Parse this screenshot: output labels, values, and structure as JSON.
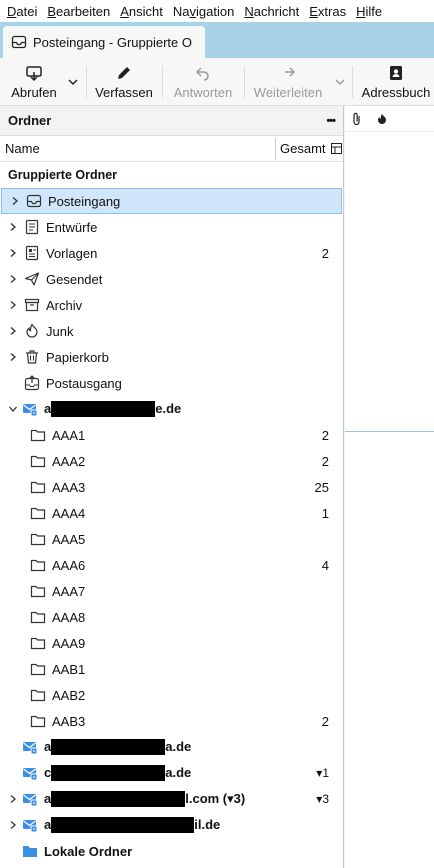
{
  "menubar": {
    "items": [
      {
        "u": "D",
        "rest": "atei"
      },
      {
        "u": "B",
        "rest": "earbeiten"
      },
      {
        "u": "A",
        "rest": "nsicht"
      },
      {
        "u": "",
        "pre": "Na",
        "mid": "v",
        "post": "igation"
      },
      {
        "u": "N",
        "rest": "achricht"
      },
      {
        "u": "E",
        "rest": "xtras"
      },
      {
        "u": "H",
        "rest": "ilfe"
      }
    ]
  },
  "tab": {
    "title": "Posteingang - Gruppierte O"
  },
  "toolbar": {
    "get_messages": "Abrufen",
    "compose": "Verfassen",
    "reply": "Antworten",
    "forward": "Weiterleiten",
    "address_book": "Adressbuch"
  },
  "folder_pane": {
    "title": "Ordner",
    "more": "•••",
    "col_name": "Name",
    "col_total": "Gesamt",
    "group_label": "Gruppierte Ordner",
    "unified": [
      {
        "name": "Posteingang",
        "count": "",
        "icon": "inbox-icon",
        "twisty": true,
        "selected": true
      },
      {
        "name": "Entwürfe",
        "count": "",
        "icon": "drafts-icon",
        "twisty": true
      },
      {
        "name": "Vorlagen",
        "count": "2",
        "icon": "templates-icon",
        "twisty": true
      },
      {
        "name": "Gesendet",
        "count": "",
        "icon": "sent-icon",
        "twisty": true
      },
      {
        "name": "Archiv",
        "count": "",
        "icon": "archive-icon",
        "twisty": true
      },
      {
        "name": "Junk",
        "count": "",
        "icon": "junk-icon",
        "twisty": true
      },
      {
        "name": "Papierkorb",
        "count": "",
        "icon": "trash-icon",
        "twisty": true
      },
      {
        "name": "Postausgang",
        "count": "",
        "icon": "outbox-icon",
        "twisty": false
      }
    ],
    "account1": {
      "prefix": "a",
      "suffix": "e.de"
    },
    "subfolders": [
      {
        "name": "AAA1",
        "count": "2"
      },
      {
        "name": "AAA2",
        "count": "2"
      },
      {
        "name": "AAA3",
        "count": "25"
      },
      {
        "name": "AAA4",
        "count": "1"
      },
      {
        "name": "AAA5",
        "count": ""
      },
      {
        "name": "AAA6",
        "count": "4"
      },
      {
        "name": "AAA7",
        "count": ""
      },
      {
        "name": "AAA8",
        "count": ""
      },
      {
        "name": "AAA9",
        "count": ""
      },
      {
        "name": "AAB1",
        "count": ""
      },
      {
        "name": "AAB2",
        "count": ""
      },
      {
        "name": "AAB3",
        "count": "2"
      }
    ],
    "accounts": [
      {
        "prefix": "a",
        "suffix": "a.de",
        "count": "",
        "twisty": false,
        "redact_w": 114
      },
      {
        "prefix": "c",
        "suffix": "a.de",
        "count": "▾1",
        "twisty": false,
        "redact_w": 114
      },
      {
        "prefix": "a",
        "suffix": "l.com (▾3)",
        "count": "▾3",
        "twisty": true,
        "redact_w": 134
      },
      {
        "prefix": "a",
        "suffix": "il.de",
        "count": "",
        "twisty": true,
        "redact_w": 143
      }
    ],
    "local_folders": "Lokale Ordner"
  }
}
